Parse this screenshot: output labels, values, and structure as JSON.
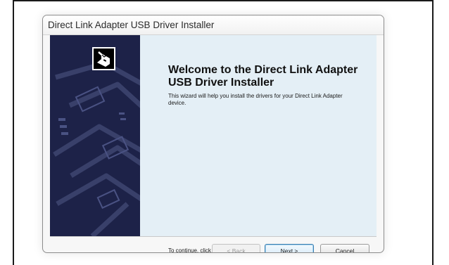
{
  "window": {
    "title": "Direct Link Adapter USB Driver Installer"
  },
  "banner": {
    "logo_icon": "usb-installer-icon",
    "background_color": "#1d2248"
  },
  "content": {
    "heading": "Welcome to the Direct Link Adapter USB Driver Installer",
    "description": "This wizard will help you install the drivers for your Direct Link Adapter device.",
    "continue_hint": "To continue, click Next."
  },
  "buttons": {
    "back": "< Back",
    "next": "Next >",
    "cancel": "Cancel"
  }
}
